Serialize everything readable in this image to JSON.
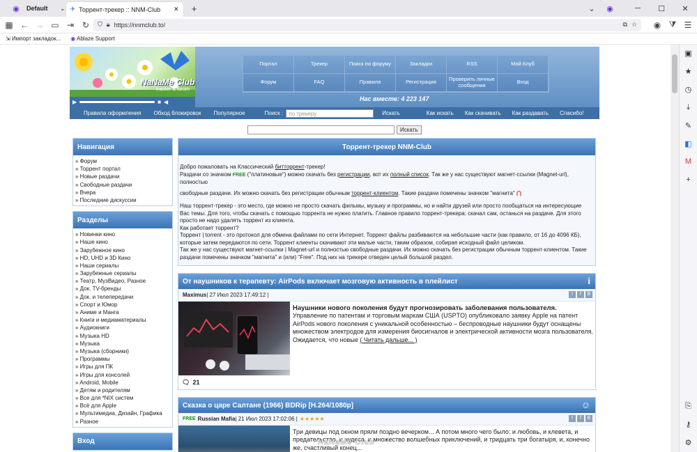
{
  "browser": {
    "profile": "Default",
    "tab_title": "Торрент-трекер :: NNM-Club",
    "url": "https://nnmclub.to/",
    "bookmarks": [
      "Импорт закладок...",
      "Ablaze Support"
    ]
  },
  "header": {
    "logo_text": "NaNaMe Club",
    "logo_sub": "tracker & forum",
    "nav_row1": [
      "Портал",
      "Трекер",
      "Поиск по форуму",
      "Закладки",
      "RSS",
      "Мой Клуб"
    ],
    "nav_row2": [
      "Форум",
      "FAQ",
      "Правила",
      "Регистрация",
      "Проверить личные сообщения",
      "Вход"
    ],
    "together": "Нас вместе: 4 223 147"
  },
  "subnav": {
    "left": [
      "Правила оформления",
      "Обход блокировок",
      "Популярное"
    ],
    "search_label": "Поиск :",
    "search_placeholder": "по трекеру",
    "search_button": "Искать",
    "right": [
      "Как искать",
      "Как скачивать",
      "Как раздавать",
      "Спасибо!"
    ]
  },
  "global_search": {
    "button": "Искать"
  },
  "navigation": {
    "title": "Навигация",
    "items": [
      "» Форум",
      "» Торрент портал",
      "» Новые раздачи",
      "» Свободные раздачи",
      "» Вчера",
      "» Последние дискуссии"
    ]
  },
  "sections": {
    "title": "Разделы",
    "items": [
      "» Новинки кино",
      "» Наше кино",
      "» Зарубежное кино",
      "» HD, UHD и 3D Кино",
      "» Наши сериалы",
      "» Зарубежные сериалы",
      "» Театр, МузВидео, Разное",
      "» Док. TV-бренды",
      "» Док. и телепередачи",
      "» Спорт и Юмор",
      "» Аниме и Манга",
      "» Книги и медиаматериалы",
      "» Аудиокниги",
      "» Музыка HD",
      "» Музыка",
      "» Музыка (сборники)",
      "» Программы",
      "» Игры для ПК",
      "» Игры для консолей",
      "» Android, Mobile",
      "» Детям и родителям",
      "» Все для *NIX систем",
      "» Всё для Apple",
      "» Мультимедиа, Дизайн, Графика",
      "» Разное"
    ]
  },
  "login": {
    "title": "Вход"
  },
  "welcome": {
    "title": "Торрент-трекер NNM-Club",
    "line1_a": "Добро пожаловать на Классический ",
    "line1_link": "битторрент",
    "line1_b": "-трекер!",
    "line2_a": "Раздачи со значком ",
    "free_badge": "FREE",
    "line2_b": " (\"платиновые\") можно скачать без ",
    "line2_link1": "регистрации",
    "line2_c": ", вот их ",
    "line2_link2": "полный список",
    "line2_d": ". Так же у нас существуют магнет-ссылки (Magnet-url), полностью",
    "line3_a": "свободные раздачи. Их можно скачать без регистрации обычным ",
    "line3_link": "торрент-клиентом",
    "line3_b": ". Такие раздачи помечены значком \"магнита\"",
    "para2": "Наш торрент-трекер - это место, где можно не просто скачать фильмы, музыку и программы, но и найти друзей или просто пообщаться на интересующие Вас темы. Для того, чтобы скачать с помощью торрента не нужно платить. Главное правило торрент-трекера: скачал сам, останься на раздаче. Для этого просто не надо удалять торрент из клиента.",
    "para3": "Как работает торрент?",
    "para4": "Торрент | torrent - это протокол для обмена файлами по сети Интернет. Торрент файлы разбиваются на небольшие части (как правило, от 16 до 4096 КБ), которые затем передаются по сети. Торрент клиенты скачивают эти малые части, таким образом, собирая исходный файл целиком.",
    "para5": "Так же у нас существуют магнет-ссылки | Magnet-url и полностью свободные раздачи. Их можно скачать без регистрации обычным торрент-клиентом. Такие раздачи помечены значком \"магнита\" и (или) \"Free\". Под них на трекере отведен целый большой раздел."
  },
  "news1": {
    "title": "От наушников к терапевту: AirPods включает мозговую активность в плейлист",
    "author": "Maximus",
    "date": " | 27 Июл 2023 17:49:12 |",
    "headline": "Наушники нового поколения будут прогнозировать заболевания пользователя.",
    "body": "Управление по патентам и торговым маркам США (USPTO) опубликовало заявку Apple на патент AirPods нового поколения с уникальной особенностью – беспроводные наушники будут оснащены множеством электродов для измерения биосигналов и электрической активности мозга пользователя.",
    "tail": "Ожидается, что новые ",
    "more": "( Читать дальше... )",
    "comments": "21"
  },
  "news2": {
    "title": "Сказка о царе Салтане (1966) BDRip [H.264/1080p]",
    "free": "FREE",
    "author": "Russian Mafia",
    "date": " | 21 Июл 2023 17:02:06 |",
    "stars": "★★★★★",
    "body": "Три девицы под окном пряли поздно вечерком... А потом много чего было: и любовь, и клевета, и предательство, и чудеса, и множество волшебных приключений, и тридцать три богатыря, и, конечно же, счастливый конец..."
  },
  "watermark": "NaNaMe Club"
}
